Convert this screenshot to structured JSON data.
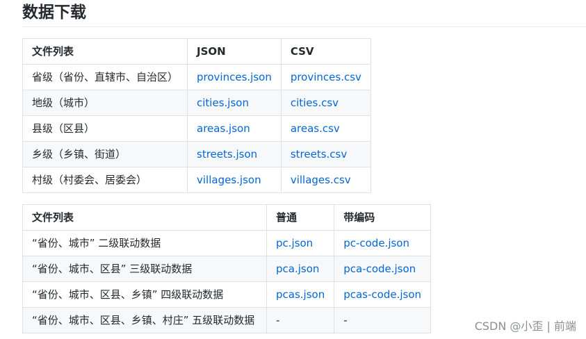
{
  "heading": "数据下载",
  "table1": {
    "headers": [
      "文件列表",
      "JSON",
      "CSV"
    ],
    "rows": [
      {
        "label": "省级（省份、直辖市、自治区）",
        "json": "provinces.json",
        "csv": "provinces.csv"
      },
      {
        "label": "地级（城市）",
        "json": "cities.json",
        "csv": "cities.csv"
      },
      {
        "label": "县级（区县）",
        "json": "areas.json",
        "csv": "areas.csv"
      },
      {
        "label": "乡级（乡镇、街道）",
        "json": "streets.json",
        "csv": "streets.csv"
      },
      {
        "label": "村级（村委会、居委会）",
        "json": "villages.json",
        "csv": "villages.csv"
      }
    ]
  },
  "table2": {
    "headers": [
      "文件列表",
      "普通",
      "带编码"
    ],
    "rows": [
      {
        "label": "“省份、城市” 二级联动数据",
        "plain": "pc.json",
        "coded": "pc-code.json"
      },
      {
        "label": "“省份、城市、区县” 三级联动数据",
        "plain": "pca.json",
        "coded": "pca-code.json"
      },
      {
        "label": "“省份、城市、区县、乡镇” 四级联动数据",
        "plain": "pcas.json",
        "coded": "pcas-code.json"
      },
      {
        "label": "“省份、城市、区县、乡镇、村庄” 五级联动数据",
        "plain": "-",
        "coded": "-"
      }
    ]
  },
  "watermark": "CSDN @小歪 | 前端",
  "colors": {
    "link": "#0366d6",
    "border": "#dfe2e5",
    "stripe": "#f6f8fa",
    "text": "#24292e",
    "watermark": "#8a8f94"
  }
}
